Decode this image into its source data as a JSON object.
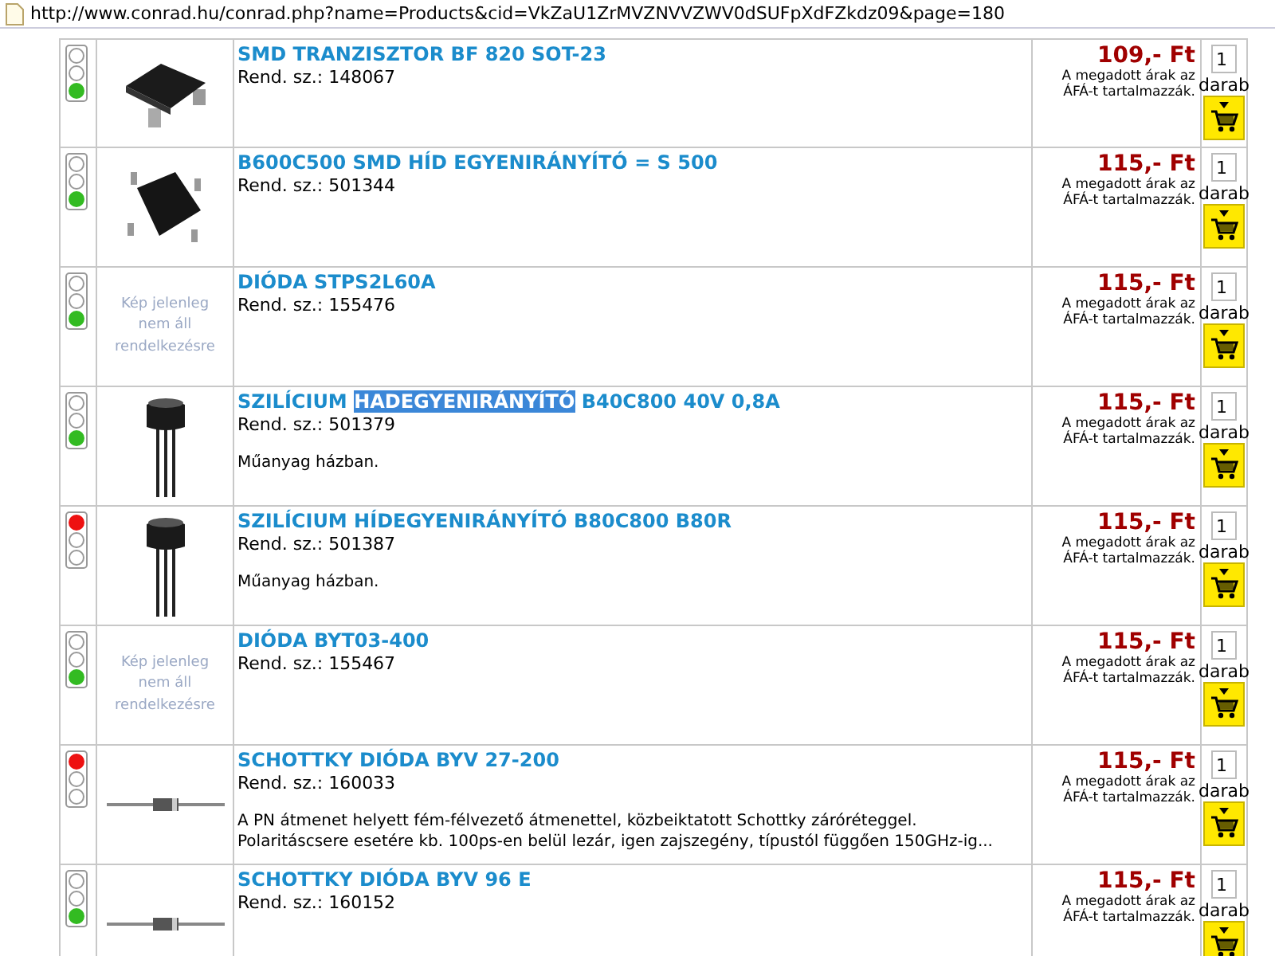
{
  "address_bar": {
    "url": "http://www.conrad.hu/conrad.php?name=Products&cid=VkZaU1ZrMVZNVVZWV0dSUFpXdFZkdz09&page=180"
  },
  "products": [
    {
      "color": "#33bb22",
      "kind": "smd-chip",
      "title": [
        {
          "text": "SMD TRANZISZTOR BF 820 SOT-23",
          "selected": false
        }
      ],
      "order_no": "Rend. sz.: 148067",
      "price": "109,- Ft",
      "vat_note": "A megadott árak az ÁFÁ-t tartalmazzák.",
      "quantity": "1",
      "unit": "darab"
    },
    {
      "color": "#33bb22",
      "kind": "bridge",
      "title": [
        {
          "text": "B600C500 SMD HÍD EGYENIRÁNYÍTÓ = S 500",
          "selected": false
        }
      ],
      "order_no": "Rend. sz.: 501344",
      "price": "115,- Ft",
      "vat_note": "A megadott árak az ÁFÁ-t tartalmazzák.",
      "quantity": "1",
      "unit": "darab"
    },
    {
      "color": "#33bb22",
      "kind": "no-image",
      "image_text": "Kép jelenleg nem áll rendelkezésre",
      "title": [
        {
          "text": "DIÓDA STPS2L60A",
          "selected": false
        }
      ],
      "order_no": "Rend. sz.: 155476",
      "price": "115,- Ft",
      "vat_note": "A megadott árak az ÁFÁ-t tartalmazzák.",
      "quantity": "1",
      "unit": "darab"
    },
    {
      "color": "#33bb22",
      "kind": "transistor",
      "title": [
        {
          "text": "SZILÍCIUM ",
          "selected": false
        },
        {
          "text": "HADEGYENIRÁNYÍTÓ",
          "selected": true
        },
        {
          "text": " B40C800 40V 0,8A",
          "selected": false
        }
      ],
      "order_no": "Rend. sz.: 501379",
      "description": "Műanyag házban.",
      "price": "115,- Ft",
      "vat_note": "A megadott árak az ÁFÁ-t tartalmazzák.",
      "quantity": "1",
      "unit": "darab"
    },
    {
      "color": "#ee1111",
      "kind": "transistor",
      "title": [
        {
          "text": "SZILÍCIUM HÍDEGYENIRÁNYÍTÓ B80C800 B80R",
          "selected": false
        }
      ],
      "order_no": "Rend. sz.: 501387",
      "description": "Műanyag házban.",
      "price": "115,- Ft",
      "vat_note": "A megadott árak az ÁFÁ-t tartalmazzák.",
      "quantity": "1",
      "unit": "darab"
    },
    {
      "color": "#33bb22",
      "kind": "no-image",
      "image_text": "Kép jelenleg nem áll rendelkezésre",
      "title": [
        {
          "text": "DIÓDA BYT03-400",
          "selected": false
        }
      ],
      "order_no": "Rend. sz.: 155467",
      "price": "115,- Ft",
      "vat_note": "A megadott árak az ÁFÁ-t tartalmazzák.",
      "quantity": "1",
      "unit": "darab"
    },
    {
      "color": "#ee1111",
      "kind": "diode",
      "title": [
        {
          "text": "SCHOTTKY DIÓDA BYV 27-200",
          "selected": false
        }
      ],
      "order_no": "Rend. sz.: 160033",
      "description": "A PN átmenet helyett fém-félvezető átmenettel, közbeiktatott Schottky záróréteggel. Polaritáscsere esetére kb. 100ps-en belül lezár, igen zajszegény, típustól függően 150GHz-ig...",
      "price": "115,- Ft",
      "vat_note": "A megadott árak az ÁFÁ-t tartalmazzák.",
      "quantity": "1",
      "unit": "darab"
    },
    {
      "color": "#33bb22",
      "kind": "diode",
      "title": [
        {
          "text": "SCHOTTKY DIÓDA BYV 96 E",
          "selected": false
        }
      ],
      "order_no": "Rend. sz.: 160152",
      "price": "115,- Ft",
      "vat_note": "A megadott árak az ÁFÁ-t tartalmazzák.",
      "quantity": "1",
      "unit": "darab"
    }
  ]
}
